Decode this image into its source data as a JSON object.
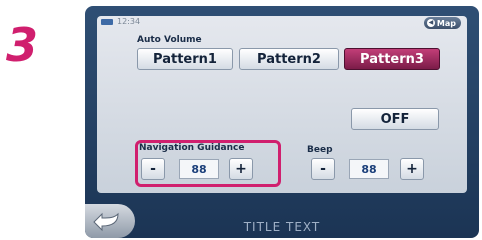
{
  "step_number": "3",
  "status_bar": {
    "time": "12:34",
    "map_label": "Map"
  },
  "auto_volume": {
    "label": "Auto Volume",
    "patterns": [
      "Pattern1",
      "Pattern2",
      "Pattern3"
    ],
    "selected": "Pattern3"
  },
  "off_button": "OFF",
  "navigation_guidance": {
    "label": "Navigation Guidance",
    "minus": "-",
    "value": "88",
    "plus": "+"
  },
  "beep": {
    "label": "Beep",
    "minus": "-",
    "value": "88",
    "plus": "+"
  },
  "footer": {
    "title": "TITLE TEXT"
  },
  "colors": {
    "accent": "#d01f6e",
    "selected_button": "#9b2a5c",
    "frame": "#244266"
  }
}
